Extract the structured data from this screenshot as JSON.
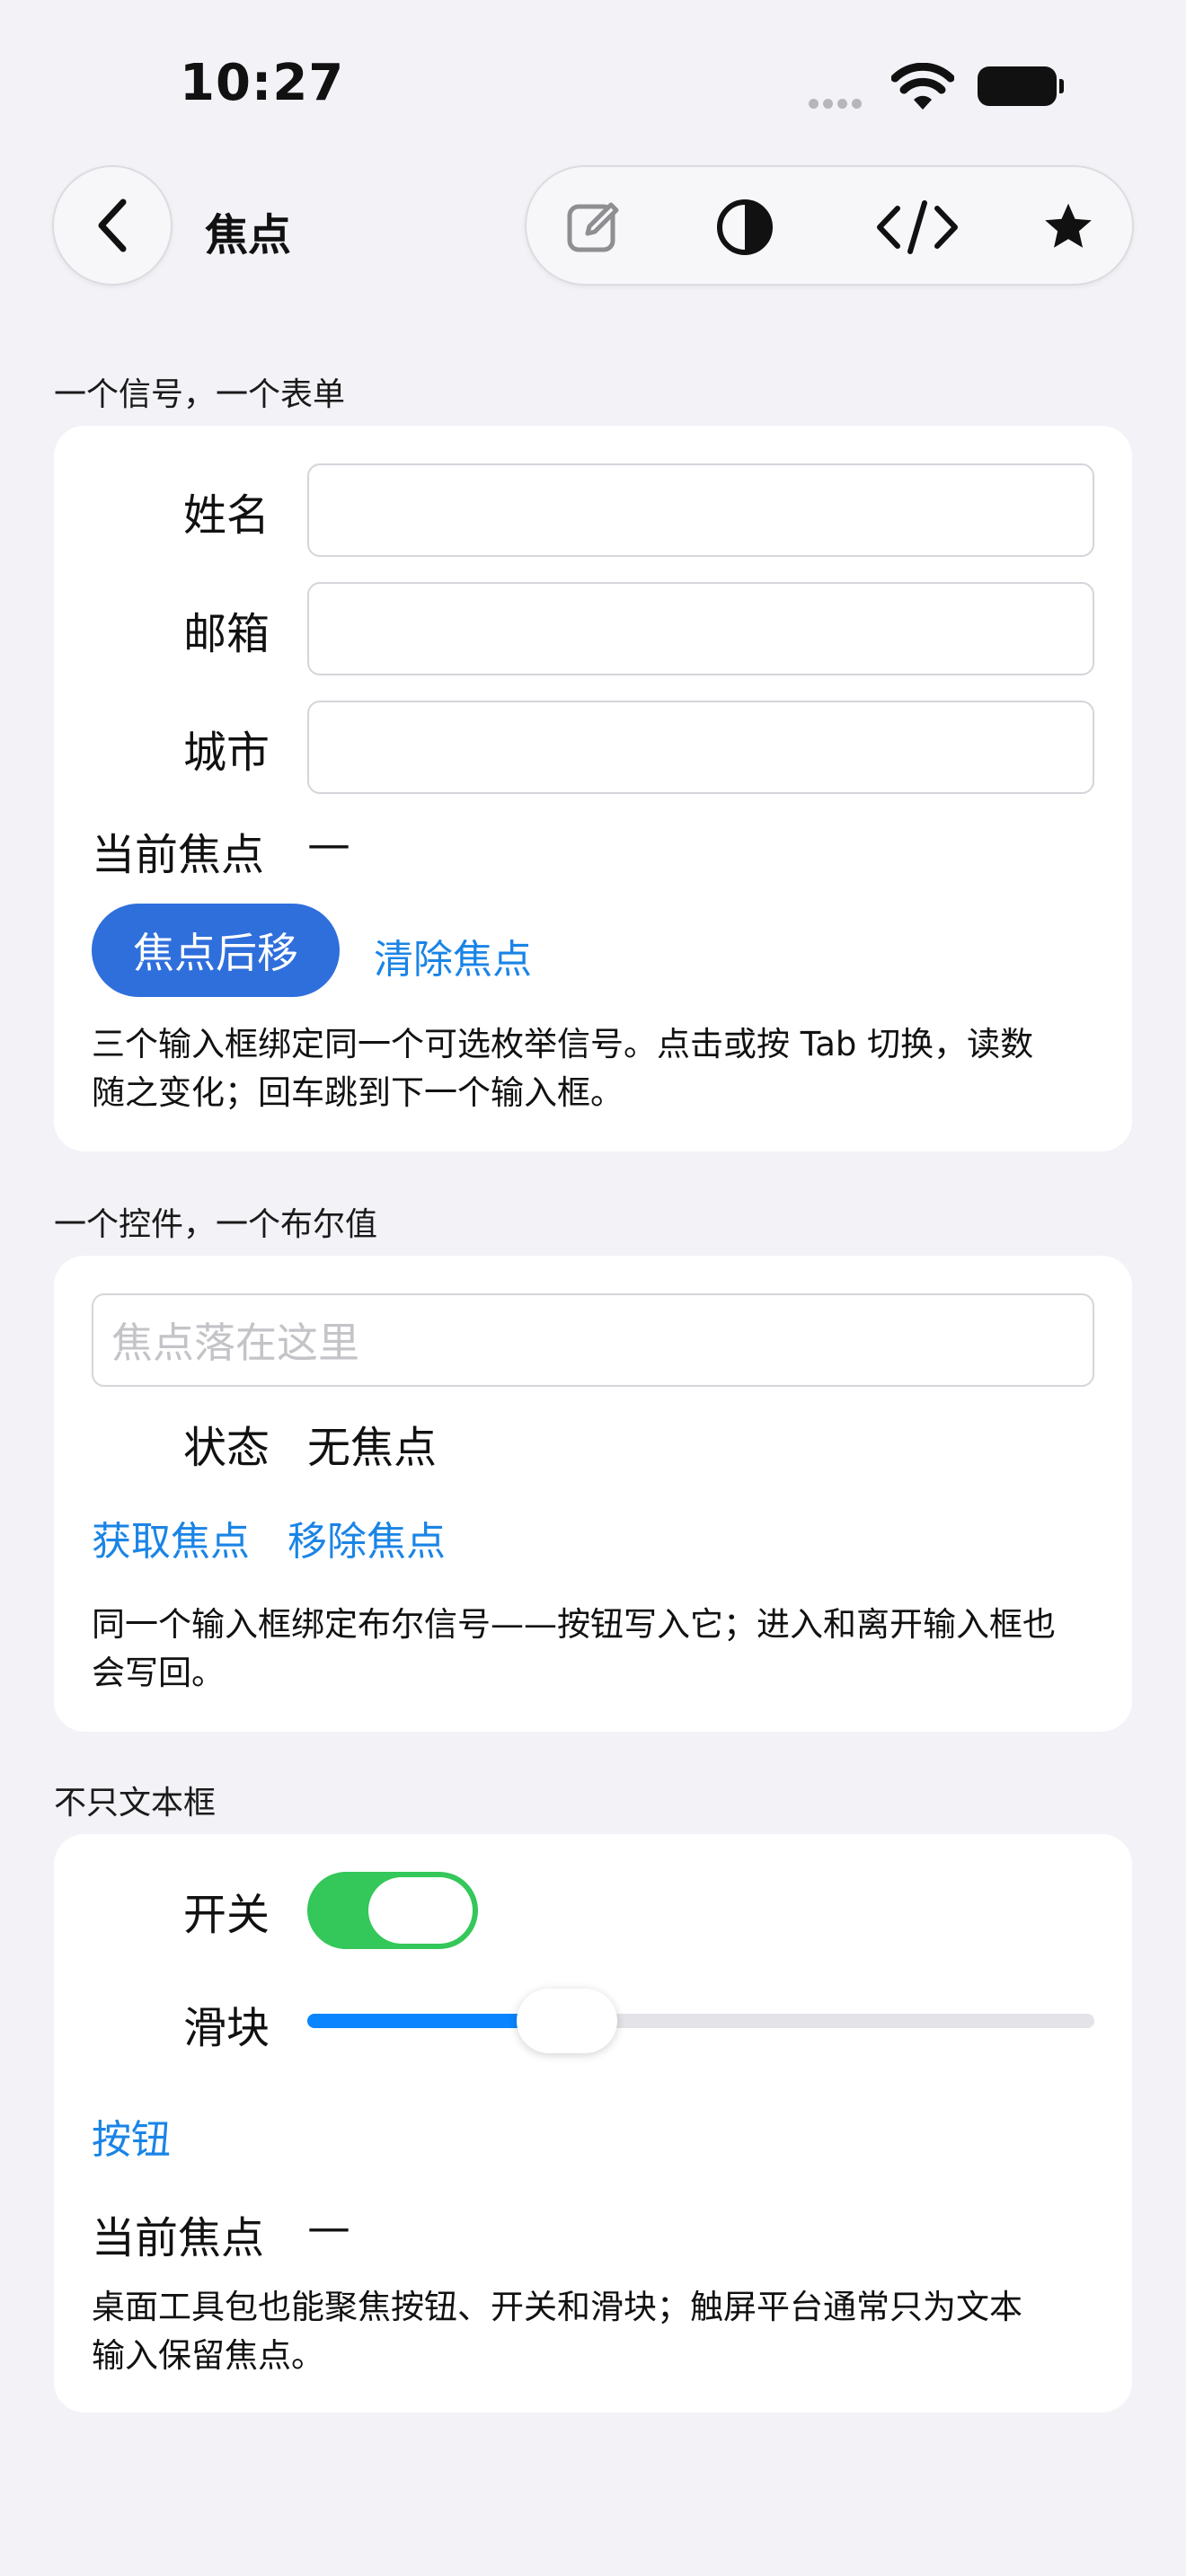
{
  "status_bar": {
    "time": "10:27"
  },
  "nav": {
    "title": "焦点",
    "toolbar_icons": [
      "edit-icon",
      "contrast-icon",
      "code-icon",
      "star-icon"
    ]
  },
  "section1": {
    "header": "一个信号，一个表单",
    "fields": [
      {
        "label": "姓名",
        "value": ""
      },
      {
        "label": "邮箱",
        "value": ""
      },
      {
        "label": "城市",
        "value": ""
      }
    ],
    "current_focus_label": "当前焦点",
    "current_focus_value": "—",
    "primary_button": "焦点后移",
    "clear_link": "清除焦点",
    "description_line1": "三个输入框绑定同一个可选枚举信号。点击或按 Tab 切换，读数",
    "description_line2": "随之变化；回车跳到下一个输入框。"
  },
  "section2": {
    "header": "一个控件，一个布尔值",
    "input_placeholder": "焦点落在这里",
    "state_label": "状态",
    "state_value": "无焦点",
    "get_focus_link": "获取焦点",
    "remove_focus_link": "移除焦点",
    "description_line1": "同一个输入框绑定布尔信号——按钮写入它；进入和离开输入框也",
    "description_line2": "会写回。"
  },
  "section3": {
    "header": "不只文本框",
    "switch_label": "开关",
    "switch_on": true,
    "slider_label": "滑块",
    "slider_value": 0.33,
    "button_link": "按钮",
    "current_focus_label": "当前焦点",
    "current_focus_value": "—",
    "description_line1": "桌面工具包也能聚焦按钮、开关和滑块；触屏平台通常只为文本",
    "description_line2": "输入保留焦点。"
  },
  "colors": {
    "accent_blue": "#2f6fdc",
    "link_blue": "#1a84e6",
    "switch_green": "#34c759",
    "background": "#f2f2f7"
  }
}
